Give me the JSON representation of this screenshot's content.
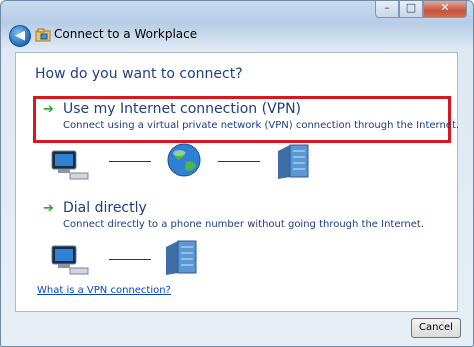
{
  "window": {
    "title": "Connect to a Workplace",
    "min_icon": "–",
    "max_icon": "□",
    "close_icon": "✕",
    "back_icon": "◀"
  },
  "question": "How do you want to connect?",
  "options": [
    {
      "arrow": "➔",
      "title": "Use my Internet connection (VPN)",
      "desc": "Connect using a virtual private network (VPN) connection through the Internet.",
      "highlight": "#d8181e"
    },
    {
      "arrow": "➔",
      "title": "Dial directly",
      "desc": "Connect directly to a phone number without going through the Internet."
    }
  ],
  "link": "What is a VPN connection?",
  "footer": {
    "cancel_label": "Cancel"
  },
  "icons": [
    "computer-icon",
    "globe-icon",
    "server-icon",
    "computer-icon",
    "server-icon"
  ]
}
